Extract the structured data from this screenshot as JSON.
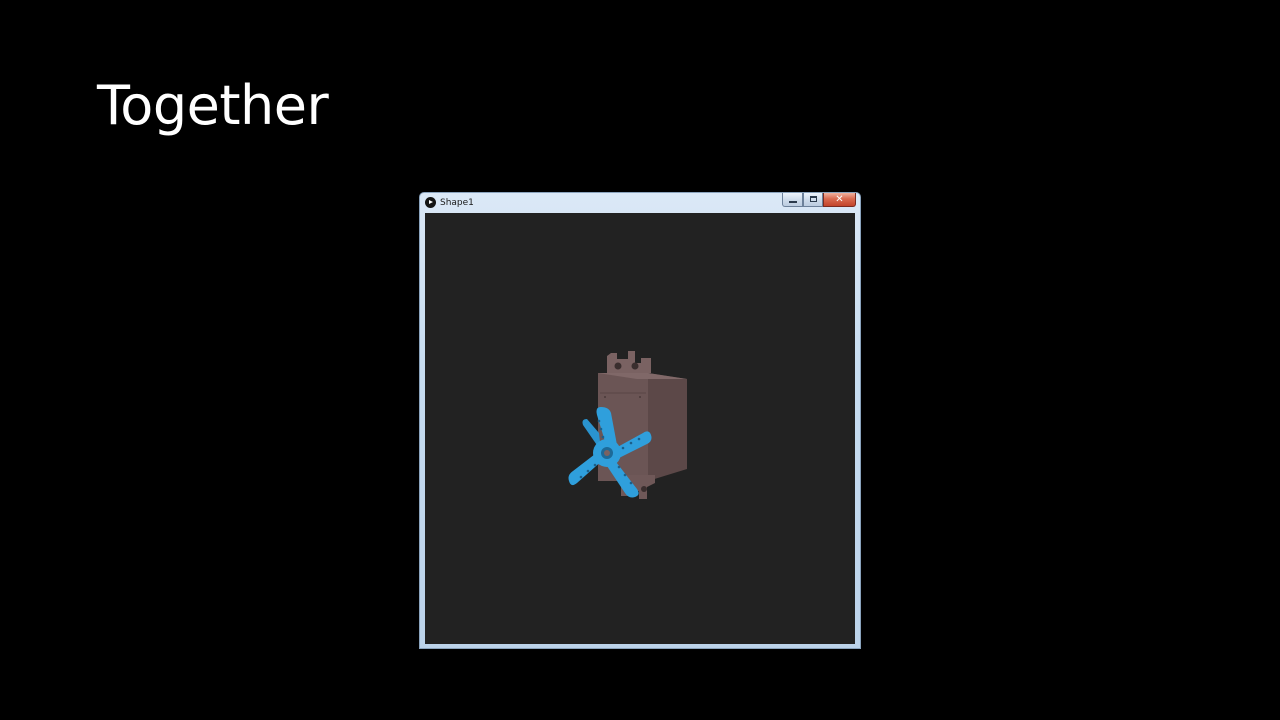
{
  "slide": {
    "title": "Together"
  },
  "window": {
    "title": "Shape1",
    "icon": "processing-play-icon",
    "controls": {
      "minimize_icon": "minimize-icon",
      "maximize_icon": "maximize-icon",
      "close_icon": "close-icon",
      "close_glyph": "✕"
    }
  },
  "scene": {
    "background": "#222222",
    "objects": [
      {
        "name": "servo-motor-body",
        "color": "#6e5857"
      },
      {
        "name": "servo-horn-star",
        "color": "#2f9fdc"
      }
    ]
  }
}
